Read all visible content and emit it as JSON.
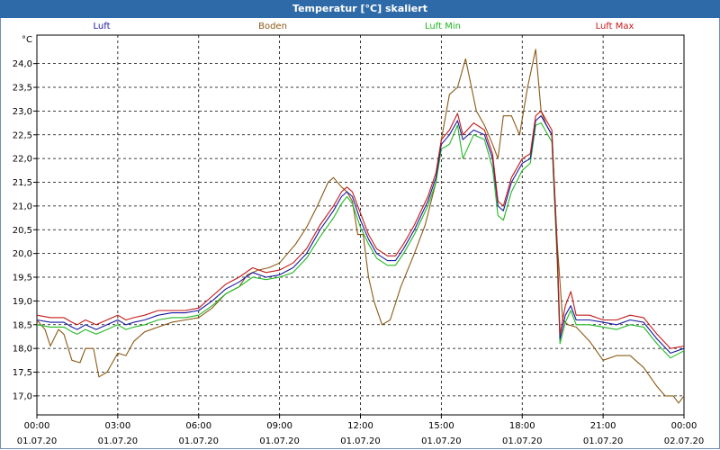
{
  "window": {
    "title": "Temperatur [°C] skaliert"
  },
  "chart_data": {
    "type": "line",
    "title": "Temperatur [°C] skaliert",
    "ylabel": "°C",
    "xlabel": "",
    "ylim": [
      16.6,
      24.6
    ],
    "xlim": [
      0,
      24
    ],
    "grid": true,
    "legend": "top",
    "y_ticks": [
      "17,0",
      "17,5",
      "18,0",
      "18,5",
      "19,0",
      "19,5",
      "20,0",
      "20,5",
      "21,0",
      "21,5",
      "22,0",
      "22,5",
      "23,0",
      "23,5",
      "24,0"
    ],
    "y_tick_values": [
      17.0,
      17.5,
      18.0,
      18.5,
      19.0,
      19.5,
      20.0,
      20.5,
      21.0,
      21.5,
      22.0,
      22.5,
      23.0,
      23.5,
      24.0
    ],
    "x_ticks": [
      {
        "time": "00:00",
        "date": "01.07.20"
      },
      {
        "time": "03:00",
        "date": "01.07.20"
      },
      {
        "time": "06:00",
        "date": "01.07.20"
      },
      {
        "time": "09:00",
        "date": "01.07.20"
      },
      {
        "time": "12:00",
        "date": "01.07.20"
      },
      {
        "time": "15:00",
        "date": "01.07.20"
      },
      {
        "time": "18:00",
        "date": "01.07.20"
      },
      {
        "time": "21:00",
        "date": "01.07.20"
      },
      {
        "time": "00:00",
        "date": "02.07.20"
      }
    ],
    "x_tick_hours": [
      0,
      3,
      6,
      9,
      12,
      15,
      18,
      21,
      24
    ],
    "series": [
      {
        "name": "Luft",
        "color": "#1a1aa0",
        "points": [
          [
            0,
            18.6
          ],
          [
            0.5,
            18.55
          ],
          [
            1,
            18.55
          ],
          [
            1.3,
            18.45
          ],
          [
            1.5,
            18.4
          ],
          [
            1.8,
            18.5
          ],
          [
            2.2,
            18.4
          ],
          [
            2.6,
            18.5
          ],
          [
            3,
            18.6
          ],
          [
            3.3,
            18.5
          ],
          [
            3.6,
            18.55
          ],
          [
            4,
            18.6
          ],
          [
            4.5,
            18.7
          ],
          [
            5,
            18.75
          ],
          [
            5.5,
            18.75
          ],
          [
            6,
            18.8
          ],
          [
            6.5,
            19.0
          ],
          [
            7,
            19.25
          ],
          [
            7.5,
            19.4
          ],
          [
            8,
            19.6
          ],
          [
            8.5,
            19.5
          ],
          [
            9,
            19.55
          ],
          [
            9.5,
            19.7
          ],
          [
            10,
            20.0
          ],
          [
            10.5,
            20.5
          ],
          [
            11,
            20.9
          ],
          [
            11.3,
            21.2
          ],
          [
            11.5,
            21.3
          ],
          [
            11.7,
            21.2
          ],
          [
            12,
            20.7
          ],
          [
            12.3,
            20.3
          ],
          [
            12.6,
            20.0
          ],
          [
            13,
            19.85
          ],
          [
            13.3,
            19.85
          ],
          [
            13.6,
            20.1
          ],
          [
            14,
            20.5
          ],
          [
            14.5,
            21.1
          ],
          [
            14.8,
            21.6
          ],
          [
            15,
            22.3
          ],
          [
            15.3,
            22.5
          ],
          [
            15.6,
            22.8
          ],
          [
            15.8,
            22.4
          ],
          [
            16.2,
            22.6
          ],
          [
            16.6,
            22.5
          ],
          [
            16.9,
            22.0
          ],
          [
            17.1,
            21.0
          ],
          [
            17.3,
            20.9
          ],
          [
            17.6,
            21.5
          ],
          [
            18,
            21.9
          ],
          [
            18.3,
            22.0
          ],
          [
            18.5,
            22.8
          ],
          [
            18.7,
            22.9
          ],
          [
            18.9,
            22.7
          ],
          [
            19.1,
            22.5
          ],
          [
            19.3,
            20.0
          ],
          [
            19.4,
            18.2
          ],
          [
            19.6,
            18.7
          ],
          [
            19.8,
            18.9
          ],
          [
            20,
            18.6
          ],
          [
            20.5,
            18.6
          ],
          [
            21,
            18.55
          ],
          [
            21.5,
            18.5
          ],
          [
            22,
            18.6
          ],
          [
            22.5,
            18.55
          ],
          [
            23,
            18.2
          ],
          [
            23.5,
            17.9
          ],
          [
            24,
            18.0
          ]
        ]
      },
      {
        "name": "Boden",
        "color": "#8b5a14",
        "points": [
          [
            0,
            18.6
          ],
          [
            0.3,
            18.4
          ],
          [
            0.5,
            18.05
          ],
          [
            0.8,
            18.4
          ],
          [
            1,
            18.3
          ],
          [
            1.3,
            17.75
          ],
          [
            1.6,
            17.7
          ],
          [
            1.8,
            18.0
          ],
          [
            2.1,
            18.0
          ],
          [
            2.3,
            17.4
          ],
          [
            2.6,
            17.5
          ],
          [
            3,
            17.9
          ],
          [
            3.3,
            17.85
          ],
          [
            3.6,
            18.15
          ],
          [
            4,
            18.35
          ],
          [
            4.5,
            18.45
          ],
          [
            5,
            18.55
          ],
          [
            5.5,
            18.6
          ],
          [
            6,
            18.65
          ],
          [
            6.5,
            18.85
          ],
          [
            7,
            19.15
          ],
          [
            7.5,
            19.3
          ],
          [
            7.8,
            19.55
          ],
          [
            8.2,
            19.65
          ],
          [
            8.6,
            19.7
          ],
          [
            9,
            19.8
          ],
          [
            9.3,
            20.0
          ],
          [
            9.6,
            20.2
          ],
          [
            10,
            20.55
          ],
          [
            10.4,
            21.0
          ],
          [
            10.8,
            21.5
          ],
          [
            11,
            21.6
          ],
          [
            11.3,
            21.4
          ],
          [
            11.5,
            21.3
          ],
          [
            11.7,
            21.1
          ],
          [
            11.9,
            20.4
          ],
          [
            12.1,
            20.4
          ],
          [
            12.3,
            19.5
          ],
          [
            12.5,
            19.0
          ],
          [
            12.8,
            18.5
          ],
          [
            13.1,
            18.6
          ],
          [
            13.5,
            19.3
          ],
          [
            14,
            20.0
          ],
          [
            14.4,
            20.6
          ],
          [
            14.8,
            21.5
          ],
          [
            15,
            22.4
          ],
          [
            15.3,
            23.35
          ],
          [
            15.6,
            23.5
          ],
          [
            15.9,
            24.1
          ],
          [
            16.3,
            23.0
          ],
          [
            16.6,
            22.7
          ],
          [
            16.9,
            22.3
          ],
          [
            17.1,
            22.0
          ],
          [
            17.3,
            22.9
          ],
          [
            17.6,
            22.9
          ],
          [
            17.9,
            22.5
          ],
          [
            18.2,
            23.5
          ],
          [
            18.5,
            24.3
          ],
          [
            18.7,
            23.0
          ],
          [
            18.9,
            22.7
          ],
          [
            19.1,
            22.5
          ],
          [
            19.3,
            20.2
          ],
          [
            19.5,
            18.6
          ],
          [
            19.7,
            18.5
          ],
          [
            20,
            18.45
          ],
          [
            20.5,
            18.15
          ],
          [
            21,
            17.75
          ],
          [
            21.5,
            17.85
          ],
          [
            22,
            17.85
          ],
          [
            22.5,
            17.6
          ],
          [
            23,
            17.2
          ],
          [
            23.3,
            17.0
          ],
          [
            23.6,
            17.0
          ],
          [
            23.8,
            16.85
          ],
          [
            24,
            17.0
          ]
        ]
      },
      {
        "name": "Luft Min",
        "color": "#22b822",
        "points": [
          [
            0,
            18.5
          ],
          [
            0.5,
            18.45
          ],
          [
            1,
            18.45
          ],
          [
            1.3,
            18.35
          ],
          [
            1.5,
            18.3
          ],
          [
            1.8,
            18.4
          ],
          [
            2.2,
            18.3
          ],
          [
            2.6,
            18.4
          ],
          [
            3,
            18.5
          ],
          [
            3.3,
            18.4
          ],
          [
            3.6,
            18.45
          ],
          [
            4,
            18.5
          ],
          [
            4.5,
            18.6
          ],
          [
            5,
            18.65
          ],
          [
            5.5,
            18.65
          ],
          [
            6,
            18.7
          ],
          [
            6.5,
            18.9
          ],
          [
            7,
            19.15
          ],
          [
            7.5,
            19.3
          ],
          [
            8,
            19.5
          ],
          [
            8.5,
            19.45
          ],
          [
            9,
            19.5
          ],
          [
            9.5,
            19.6
          ],
          [
            10,
            19.9
          ],
          [
            10.5,
            20.35
          ],
          [
            11,
            20.75
          ],
          [
            11.3,
            21.05
          ],
          [
            11.5,
            21.2
          ],
          [
            11.7,
            21.05
          ],
          [
            12,
            20.55
          ],
          [
            12.3,
            20.2
          ],
          [
            12.6,
            19.9
          ],
          [
            13,
            19.75
          ],
          [
            13.3,
            19.75
          ],
          [
            13.6,
            20.0
          ],
          [
            14,
            20.4
          ],
          [
            14.5,
            21.0
          ],
          [
            14.8,
            21.5
          ],
          [
            15,
            22.2
          ],
          [
            15.3,
            22.3
          ],
          [
            15.6,
            22.7
          ],
          [
            15.8,
            22.0
          ],
          [
            16.2,
            22.5
          ],
          [
            16.6,
            22.4
          ],
          [
            16.9,
            21.8
          ],
          [
            17.1,
            20.8
          ],
          [
            17.3,
            20.7
          ],
          [
            17.6,
            21.3
          ],
          [
            18,
            21.75
          ],
          [
            18.3,
            21.9
          ],
          [
            18.5,
            22.7
          ],
          [
            18.7,
            22.75
          ],
          [
            18.9,
            22.55
          ],
          [
            19.1,
            22.35
          ],
          [
            19.3,
            19.8
          ],
          [
            19.4,
            18.1
          ],
          [
            19.6,
            18.55
          ],
          [
            19.8,
            18.8
          ],
          [
            20,
            18.5
          ],
          [
            20.5,
            18.5
          ],
          [
            21,
            18.45
          ],
          [
            21.5,
            18.4
          ],
          [
            22,
            18.5
          ],
          [
            22.5,
            18.45
          ],
          [
            23,
            18.1
          ],
          [
            23.5,
            17.8
          ],
          [
            24,
            17.95
          ]
        ]
      },
      {
        "name": "Luft Max",
        "color": "#c41a1a",
        "points": [
          [
            0,
            18.7
          ],
          [
            0.5,
            18.65
          ],
          [
            1,
            18.65
          ],
          [
            1.3,
            18.55
          ],
          [
            1.5,
            18.5
          ],
          [
            1.8,
            18.6
          ],
          [
            2.2,
            18.5
          ],
          [
            2.6,
            18.6
          ],
          [
            3,
            18.7
          ],
          [
            3.3,
            18.6
          ],
          [
            3.6,
            18.65
          ],
          [
            4,
            18.7
          ],
          [
            4.5,
            18.8
          ],
          [
            5,
            18.8
          ],
          [
            5.5,
            18.8
          ],
          [
            6,
            18.85
          ],
          [
            6.5,
            19.1
          ],
          [
            7,
            19.35
          ],
          [
            7.5,
            19.5
          ],
          [
            8,
            19.7
          ],
          [
            8.5,
            19.6
          ],
          [
            9,
            19.65
          ],
          [
            9.5,
            19.8
          ],
          [
            10,
            20.1
          ],
          [
            10.5,
            20.6
          ],
          [
            11,
            21.0
          ],
          [
            11.3,
            21.3
          ],
          [
            11.5,
            21.4
          ],
          [
            11.7,
            21.3
          ],
          [
            12,
            20.85
          ],
          [
            12.3,
            20.4
          ],
          [
            12.6,
            20.1
          ],
          [
            13,
            19.95
          ],
          [
            13.3,
            19.95
          ],
          [
            13.6,
            20.2
          ],
          [
            14,
            20.6
          ],
          [
            14.5,
            21.2
          ],
          [
            14.8,
            21.7
          ],
          [
            15,
            22.4
          ],
          [
            15.3,
            22.6
          ],
          [
            15.6,
            22.95
          ],
          [
            15.8,
            22.5
          ],
          [
            16.2,
            22.75
          ],
          [
            16.6,
            22.6
          ],
          [
            16.9,
            22.1
          ],
          [
            17.1,
            21.1
          ],
          [
            17.3,
            21.0
          ],
          [
            17.6,
            21.6
          ],
          [
            18,
            22.0
          ],
          [
            18.3,
            22.1
          ],
          [
            18.5,
            22.9
          ],
          [
            18.7,
            23.0
          ],
          [
            18.9,
            22.8
          ],
          [
            19.1,
            22.6
          ],
          [
            19.3,
            20.1
          ],
          [
            19.4,
            18.3
          ],
          [
            19.6,
            18.9
          ],
          [
            19.8,
            19.2
          ],
          [
            20,
            18.7
          ],
          [
            20.5,
            18.7
          ],
          [
            21,
            18.6
          ],
          [
            21.5,
            18.6
          ],
          [
            22,
            18.7
          ],
          [
            22.5,
            18.65
          ],
          [
            23,
            18.3
          ],
          [
            23.5,
            18.0
          ],
          [
            24,
            18.05
          ]
        ]
      }
    ]
  }
}
